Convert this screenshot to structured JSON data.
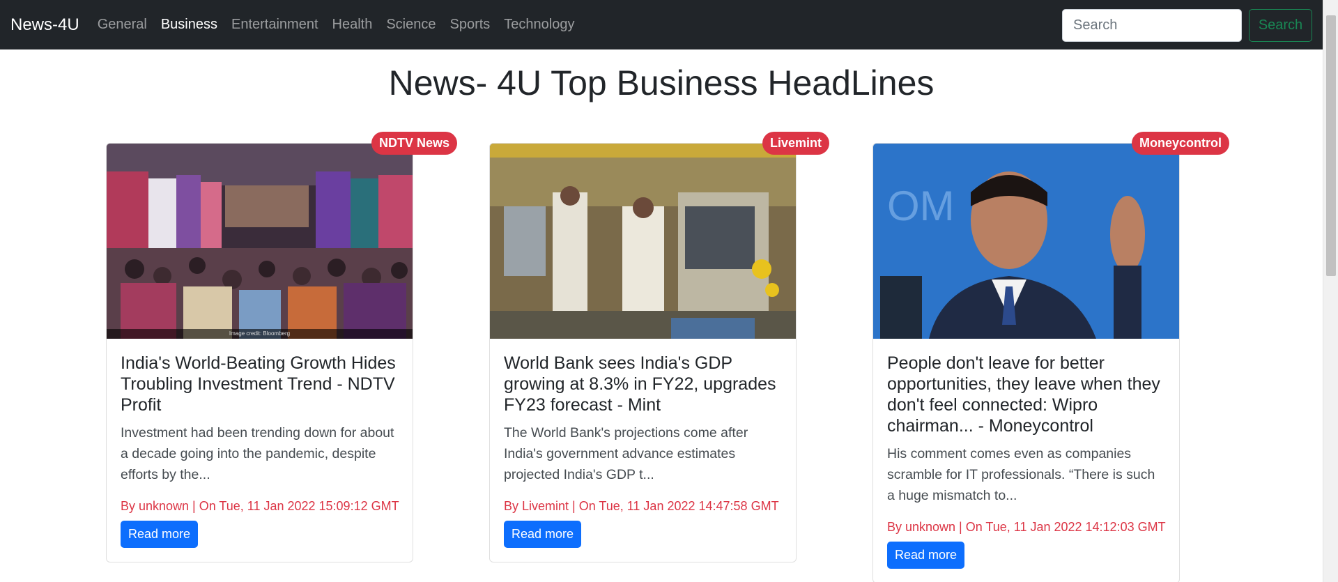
{
  "navbar": {
    "brand": "News-4U",
    "links": [
      "General",
      "Business",
      "Entertainment",
      "Health",
      "Science",
      "Sports",
      "Technology"
    ],
    "active_link": "Business",
    "search_placeholder": "Search",
    "search_button": "Search"
  },
  "page_title": "News- 4U Top Business HeadLines",
  "articles": [
    {
      "source": "NDTV News",
      "title": "India's World-Beating Growth Hides Troubling Investment Trend - NDTV Profit",
      "description": "Investment had been trending down for about a decade going into the pandemic, despite efforts by the...",
      "meta": "By unknown | On Tue, 11 Jan 2022 15:09:12 GMT",
      "read_more": "Read more",
      "image_credit": "Image credit: Bloomberg"
    },
    {
      "source": "Livemint",
      "title": "World Bank sees India's GDP growing at 8.3% in FY22, upgrades FY23 forecast - Mint",
      "description": "The World Bank's projections come after India's government advance estimates projected India's GDP t...",
      "meta": "By Livemint | On Tue, 11 Jan 2022 14:47:58 GMT",
      "read_more": "Read more"
    },
    {
      "source": "Moneycontrol",
      "title": "People don't leave for better opportunities, they leave when they don't feel connected: Wipro chairman... - Moneycontrol",
      "description": "His comment comes even as companies scramble for IT professionals. “There is such a huge mismatch to...",
      "meta": "By unknown | On Tue, 11 Jan 2022 14:12:03 GMT",
      "read_more": "Read more"
    }
  ],
  "colors": {
    "navbar_bg": "#212529",
    "badge": "#dc3545",
    "meta_text": "#dc3545",
    "button": "#0d6efd",
    "search_button": "#198754"
  }
}
